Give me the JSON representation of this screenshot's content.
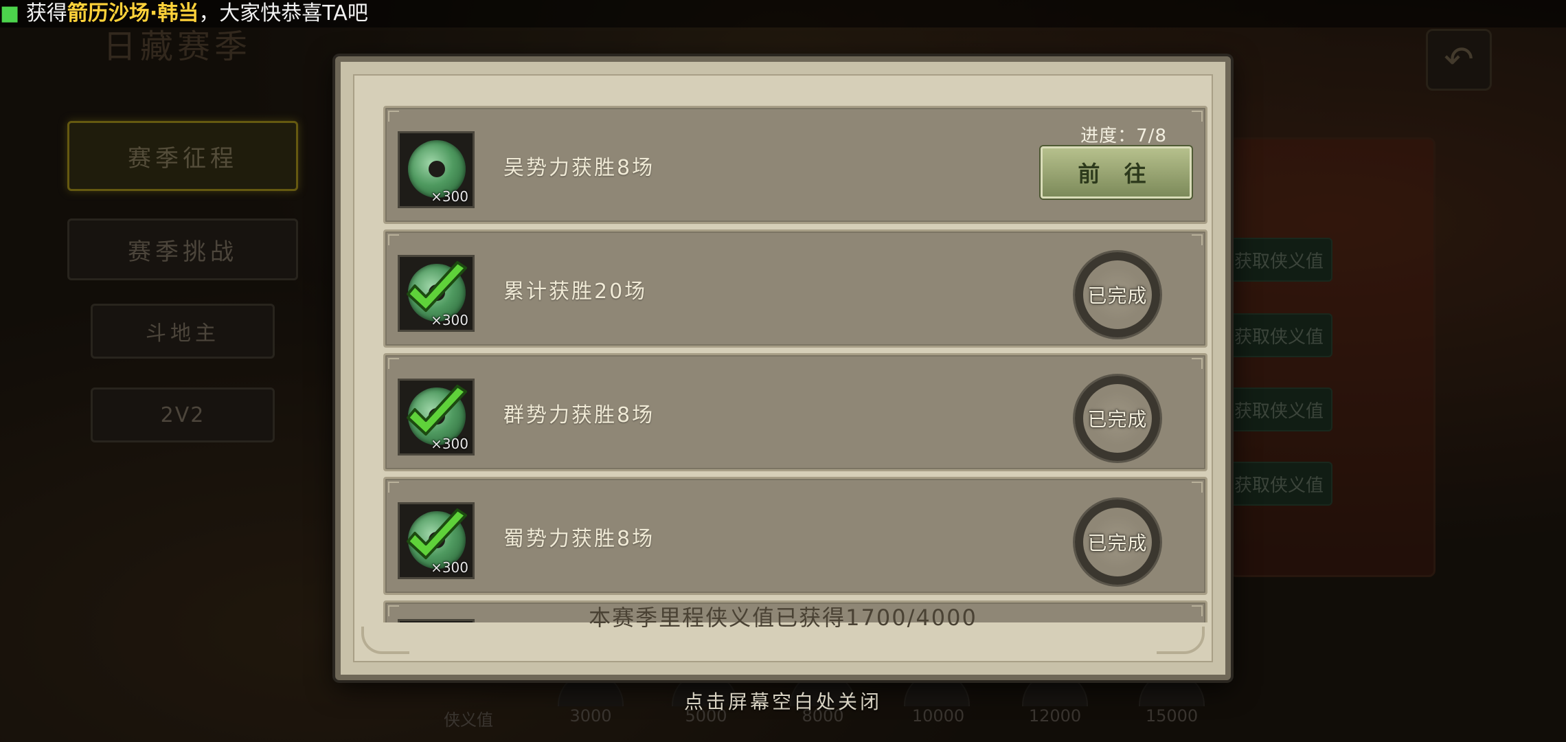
{
  "broadcast": {
    "prefix": "获得",
    "title": "箭历沙场",
    "name": "韩当",
    "suffix": "，大家快恭喜TA吧"
  },
  "background": {
    "title": "日藏赛季",
    "menu": [
      "赛季征程",
      "赛季挑战",
      "斗地主",
      "2V2"
    ],
    "claim_buttons": [
      "获取侠义值",
      "获取侠义值",
      "获取侠义值",
      "获取侠义值"
    ],
    "milestones": [
      "侠义值",
      "3000",
      "5000",
      "8000",
      "10000",
      "12000",
      "15000"
    ]
  },
  "modal": {
    "tasks": [
      {
        "name": "吴势力获胜8场",
        "reward_qty": "×300",
        "status": "in_progress",
        "progress_label": "进度：7/8",
        "action_label": "前 往"
      },
      {
        "name": "累计获胜20场",
        "reward_qty": "×300",
        "status": "done",
        "done_label": "已完成"
      },
      {
        "name": "群势力获胜8场",
        "reward_qty": "×300",
        "status": "done",
        "done_label": "已完成"
      },
      {
        "name": "蜀势力获胜8场",
        "reward_qty": "×300",
        "status": "done",
        "done_label": "已完成"
      }
    ],
    "summary": "本赛季里程侠义值已获得1700/4000"
  },
  "close_hint": "点击屏幕空白处关闭",
  "colors": {
    "highlight": "#ffd23a",
    "modal_bg": "#d6cfb8",
    "row_bg": "#8f8776",
    "go_button": "#9aa672"
  }
}
